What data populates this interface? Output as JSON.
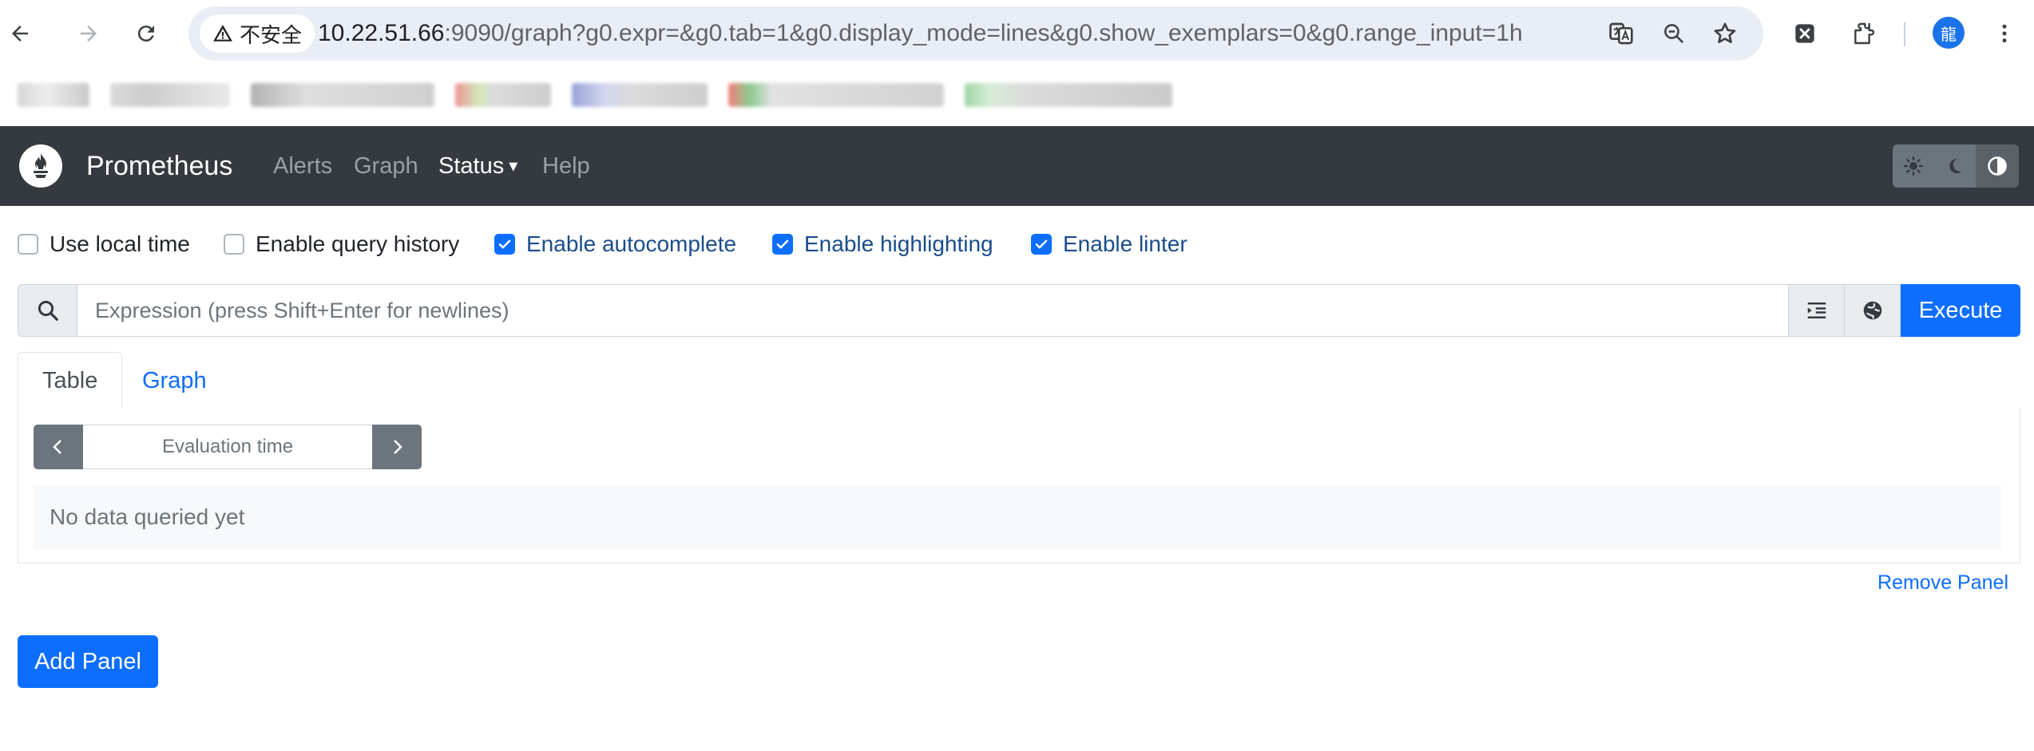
{
  "browser": {
    "security_label": "不安全",
    "url_host": "10.22.51.66",
    "url_rest": ":9090/graph?g0.expr=&g0.tab=1&g0.display_mode=lines&g0.show_exemplars=0&g0.range_input=1h",
    "profile_initial": "龍"
  },
  "navbar": {
    "brand": "Prometheus",
    "links": [
      "Alerts",
      "Graph",
      "Status",
      "Help"
    ],
    "status_caret": "▾"
  },
  "options": [
    {
      "label": "Use local time",
      "checked": false
    },
    {
      "label": "Enable query history",
      "checked": false
    },
    {
      "label": "Enable autocomplete",
      "checked": true
    },
    {
      "label": "Enable highlighting",
      "checked": true
    },
    {
      "label": "Enable linter",
      "checked": true
    }
  ],
  "expression": {
    "placeholder": "Expression (press Shift+Enter for newlines)",
    "value": "",
    "execute_label": "Execute"
  },
  "tabs": {
    "table": "Table",
    "graph": "Graph",
    "active": "Table"
  },
  "table_panel": {
    "evaluation_placeholder": "Evaluation time",
    "no_data": "No data queried yet"
  },
  "remove_panel": "Remove Panel",
  "add_panel": "Add Panel",
  "colors": {
    "navbar_bg": "#343a40",
    "primary": "#0d6efd",
    "secondary": "#6c757d"
  }
}
